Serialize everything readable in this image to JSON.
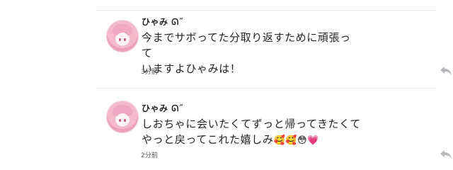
{
  "comments": [
    {
      "username": "ひゃみ",
      "text_line1": "今までサボってた分取り返すために頑張って",
      "text_line2": "いますよひゃみは！",
      "time": "3分前"
    },
    {
      "username": "ひゃみ",
      "text_line1": "しおちゃに会いたくてずっと帰ってきたくて",
      "text_line2": "やっと戻ってこれた嬉しみ",
      "emojis": "🥰🥰😳💗",
      "time": "2分前"
    }
  ],
  "icons": {
    "reply": "reply-arrow-icon",
    "name_badge": "swirl-icon"
  },
  "colors": {
    "divider": "#e9e9ea",
    "reply_icon": "#b7b7bb",
    "avatar_hair": "#f0a9c2"
  }
}
